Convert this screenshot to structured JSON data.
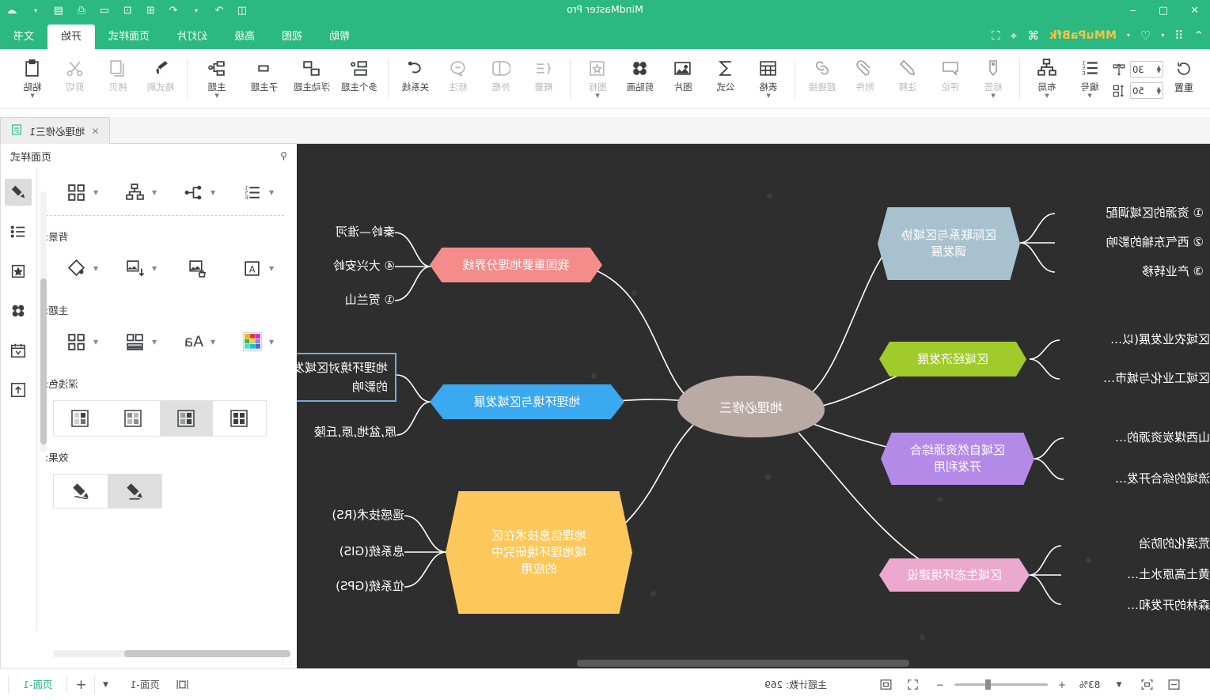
{
  "window": {
    "title": "MindMaster Pro",
    "controls": {
      "close": "✕",
      "maximize": "▢",
      "minimize": "‒"
    },
    "right_icons": [
      "cloud-sync",
      "chevron-down",
      "save",
      "print",
      "present",
      "screen",
      "new-window",
      "export",
      "undo",
      "redo",
      "dropdown",
      "account"
    ]
  },
  "quick_access": {
    "brand": "MMuPaBfk",
    "icons": [
      "collapse-ribbon-icon",
      "grid-icon",
      "caret-icon",
      "shirt-icon",
      "caret2-icon",
      "share-icon",
      "cursor-icon",
      "fullscreen-icon"
    ]
  },
  "ribbon_tabs": [
    {
      "label": "文书",
      "active": false
    },
    {
      "label": "开始",
      "active": true
    },
    {
      "label": "页面样式",
      "active": false
    },
    {
      "label": "幻灯片",
      "active": false
    },
    {
      "label": "高级",
      "active": false
    },
    {
      "label": "视图",
      "active": false
    },
    {
      "label": "帮助",
      "active": false
    }
  ],
  "ribbon": {
    "groups": [
      {
        "name": "clipboard",
        "buttons": [
          {
            "label": "粘贴",
            "icon": "paste-icon",
            "dropdown": true,
            "dim": false
          },
          {
            "label": "剪切",
            "icon": "scissors-icon",
            "dropdown": false,
            "dim": true
          },
          {
            "label": "拷贝",
            "icon": "copy-icon",
            "dropdown": false,
            "dim": true
          },
          {
            "label": "格式刷",
            "icon": "format-painter-icon",
            "dropdown": false,
            "dim": true
          }
        ]
      },
      {
        "name": "topics",
        "buttons": [
          {
            "label": "主题",
            "icon": "topic-icon",
            "dropdown": true,
            "dim": false
          },
          {
            "label": "子主题",
            "icon": "subtopic-icon",
            "dropdown": false,
            "dim": false
          },
          {
            "label": "浮动主题",
            "icon": "floating-topic-icon",
            "dropdown": false,
            "dim": false
          },
          {
            "label": "多个主题",
            "icon": "multi-topic-icon",
            "dropdown": false,
            "dim": false
          }
        ]
      },
      {
        "name": "annotate",
        "buttons": [
          {
            "label": "关系线",
            "icon": "relationship-icon",
            "dropdown": false,
            "dim": false
          },
          {
            "label": "标注",
            "icon": "callout-icon",
            "dropdown": false,
            "dim": true
          },
          {
            "label": "外框",
            "icon": "boundary-icon",
            "dropdown": false,
            "dim": true
          },
          {
            "label": "概要",
            "icon": "summary-icon",
            "dropdown": false,
            "dim": true
          }
        ]
      },
      {
        "name": "insert",
        "buttons": [
          {
            "label": "图标",
            "icon": "sticker-icon",
            "dropdown": true,
            "dim": true
          },
          {
            "label": "剪贴画",
            "icon": "clipart-icon",
            "dropdown": false,
            "dim": false
          },
          {
            "label": "图片",
            "icon": "image-icon",
            "dropdown": false,
            "dim": false
          },
          {
            "label": "公式",
            "icon": "formula-icon",
            "dropdown": false,
            "dim": false
          },
          {
            "label": "表格",
            "icon": "table-icon",
            "dropdown": true,
            "dim": false
          }
        ]
      },
      {
        "name": "attach",
        "buttons": [
          {
            "label": "超链接",
            "icon": "link-icon",
            "dropdown": false,
            "dim": true
          },
          {
            "label": "附件",
            "icon": "paperclip-icon",
            "dropdown": false,
            "dim": true
          },
          {
            "label": "注释",
            "icon": "pencil-note-icon",
            "dropdown": false,
            "dim": true
          },
          {
            "label": "评论",
            "icon": "comment-icon",
            "dropdown": false,
            "dim": true
          },
          {
            "label": "标签",
            "icon": "tag-icon",
            "dropdown": true,
            "dim": true
          }
        ]
      },
      {
        "name": "layout",
        "buttons": [
          {
            "label": "布局",
            "icon": "layout-icon",
            "dropdown": true,
            "dim": false
          },
          {
            "label": "编号",
            "icon": "numbering-icon",
            "dropdown": true,
            "dim": false
          }
        ]
      }
    ],
    "spacing": {
      "row1_value": "30",
      "row2_value": "50",
      "row1_icon": "horizontal-spacing-icon",
      "row2_icon": "vertical-spacing-icon",
      "reset_label": "重置",
      "reset_icon": "reset-icon"
    }
  },
  "left_panel": {
    "title": "页面样式",
    "pin_icon": "pin-icon",
    "style_row": [
      {
        "icon": "numbering-style-icon"
      },
      {
        "icon": "branch-style-icon"
      },
      {
        "icon": "layout-style-icon"
      },
      {
        "icon": "theme-grid-icon"
      }
    ],
    "sections": [
      {
        "label": "背景:",
        "items": [
          {
            "icon": "watermark-text-icon"
          },
          {
            "icon": "remove-image-icon"
          },
          {
            "icon": "insert-image-icon"
          },
          {
            "icon": "fill-color-icon"
          }
        ]
      },
      {
        "label": "主题:",
        "items": [
          {
            "icon": "color-palette-icon"
          },
          {
            "icon": "font-style-icon"
          },
          {
            "icon": "shape-style-icon"
          },
          {
            "icon": "theme-set-icon"
          }
        ]
      }
    ],
    "tone": {
      "label": "深浅色:",
      "options": [
        "tone-1",
        "tone-2",
        "tone-3",
        "tone-4"
      ],
      "selected_index": 2
    },
    "effect": {
      "label": "效果:",
      "options": [
        "hand-drawn-effect",
        "solid-effect"
      ],
      "selected_index": 1
    },
    "rail": [
      {
        "icon": "style-brush-icon",
        "active": true
      },
      {
        "icon": "outline-list-icon",
        "active": false
      },
      {
        "icon": "sticker-panel-icon",
        "active": false
      },
      {
        "icon": "clipart-panel-icon",
        "active": false
      },
      {
        "icon": "calendar-panel-icon",
        "active": false
      },
      {
        "icon": "export-panel-icon",
        "active": false
      }
    ]
  },
  "document_tab": {
    "icon": "mindmap-file-icon",
    "title": "地理必修三1",
    "close_icon": "✕"
  },
  "mindmap": {
    "central": "地理必修三",
    "central_color": "#b9aaa5",
    "branches": [
      {
        "text": "我国重要地理分界线",
        "color": "#f58c8c",
        "side": "right",
        "children": [
          "秦岭—淮河",
          "④ 大兴安岭",
          "① 贺兰山"
        ]
      },
      {
        "text": "地理环境与区域发展",
        "color": "#3ba9f0",
        "side": "right",
        "children": [
          "地理环境对区域发展的影响",
          "原,盆地,原,丘陵"
        ],
        "selected_child_index": 0
      },
      {
        "text": "地理信息技术在区域地理环境研究中的应用",
        "color": "#fcc85b",
        "side": "right",
        "children": [
          "遥感技术(RS)",
          "息系统(GIS)",
          "位系统(GPS)"
        ]
      },
      {
        "text": "区际联系与区域协调发展",
        "color": "#a7c2ce",
        "side": "left",
        "children": [
          "① 资源的区域调配",
          "② 西气东输的影响",
          "③ 产业转移"
        ]
      },
      {
        "text": "区域经济发展",
        "color": "#a0cb2a",
        "side": "left",
        "children": [
          "区域农业发展(以…",
          "区域工业化与城市…"
        ]
      },
      {
        "text": "区域自然资源综合开发利用",
        "color": "#b48ae8",
        "side": "left",
        "children": [
          "山西煤炭资源的…",
          "流域的综合开发…"
        ]
      },
      {
        "text": "区域生态环境建设",
        "color": "#eaa9cd",
        "side": "left",
        "children": [
          "荒漠化的防治",
          "黄土高原水土…",
          "森林的开发和…"
        ]
      }
    ]
  },
  "status_bar": {
    "left_icons": [
      "fit-page-icon",
      "fit-selection-icon"
    ],
    "zoom_dropdown_icon": "caret-icon",
    "zoom_level": "83%",
    "zoom_in": "+",
    "zoom_out": "−",
    "expand_icon": "expand-icon",
    "center_icon": "center-icon",
    "topic_count_label": "主题计数:",
    "topic_count_value": "269",
    "page_tab_active": "页面-1",
    "page_tab_plain": "页面-1",
    "add_page": "+",
    "page_menu": "▼",
    "view_mode_icon": "split-view-icon"
  }
}
